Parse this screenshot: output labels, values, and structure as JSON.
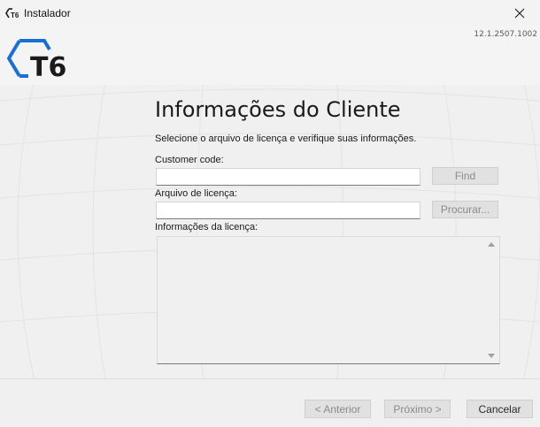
{
  "window": {
    "title": "Instalador",
    "logo_icon": "t6-small-logo-icon",
    "close_icon": "close-icon"
  },
  "header": {
    "logo_icon": "t6-logo-icon",
    "logo_text": "T6",
    "version": "12.1.2507.1002"
  },
  "main": {
    "title": "Informações do Cliente",
    "subtitle": "Selecione o arquivo de licença e verifique suas informações.",
    "customer_code": {
      "label": "Customer code:",
      "value": "",
      "button": "Find"
    },
    "license_file": {
      "label": "Arquivo de licença:",
      "value": "",
      "button": "Procurar..."
    },
    "license_info": {
      "label": "Informações da licença:",
      "value": ""
    }
  },
  "footer": {
    "back": "< Anterior",
    "next": "Próximo >",
    "cancel": "Cancelar"
  },
  "colors": {
    "logo_blue": "#1a6fd0",
    "logo_dark": "#1a1a1a",
    "background": "#f0f0f0",
    "disabled_text": "#8a8a8a"
  }
}
